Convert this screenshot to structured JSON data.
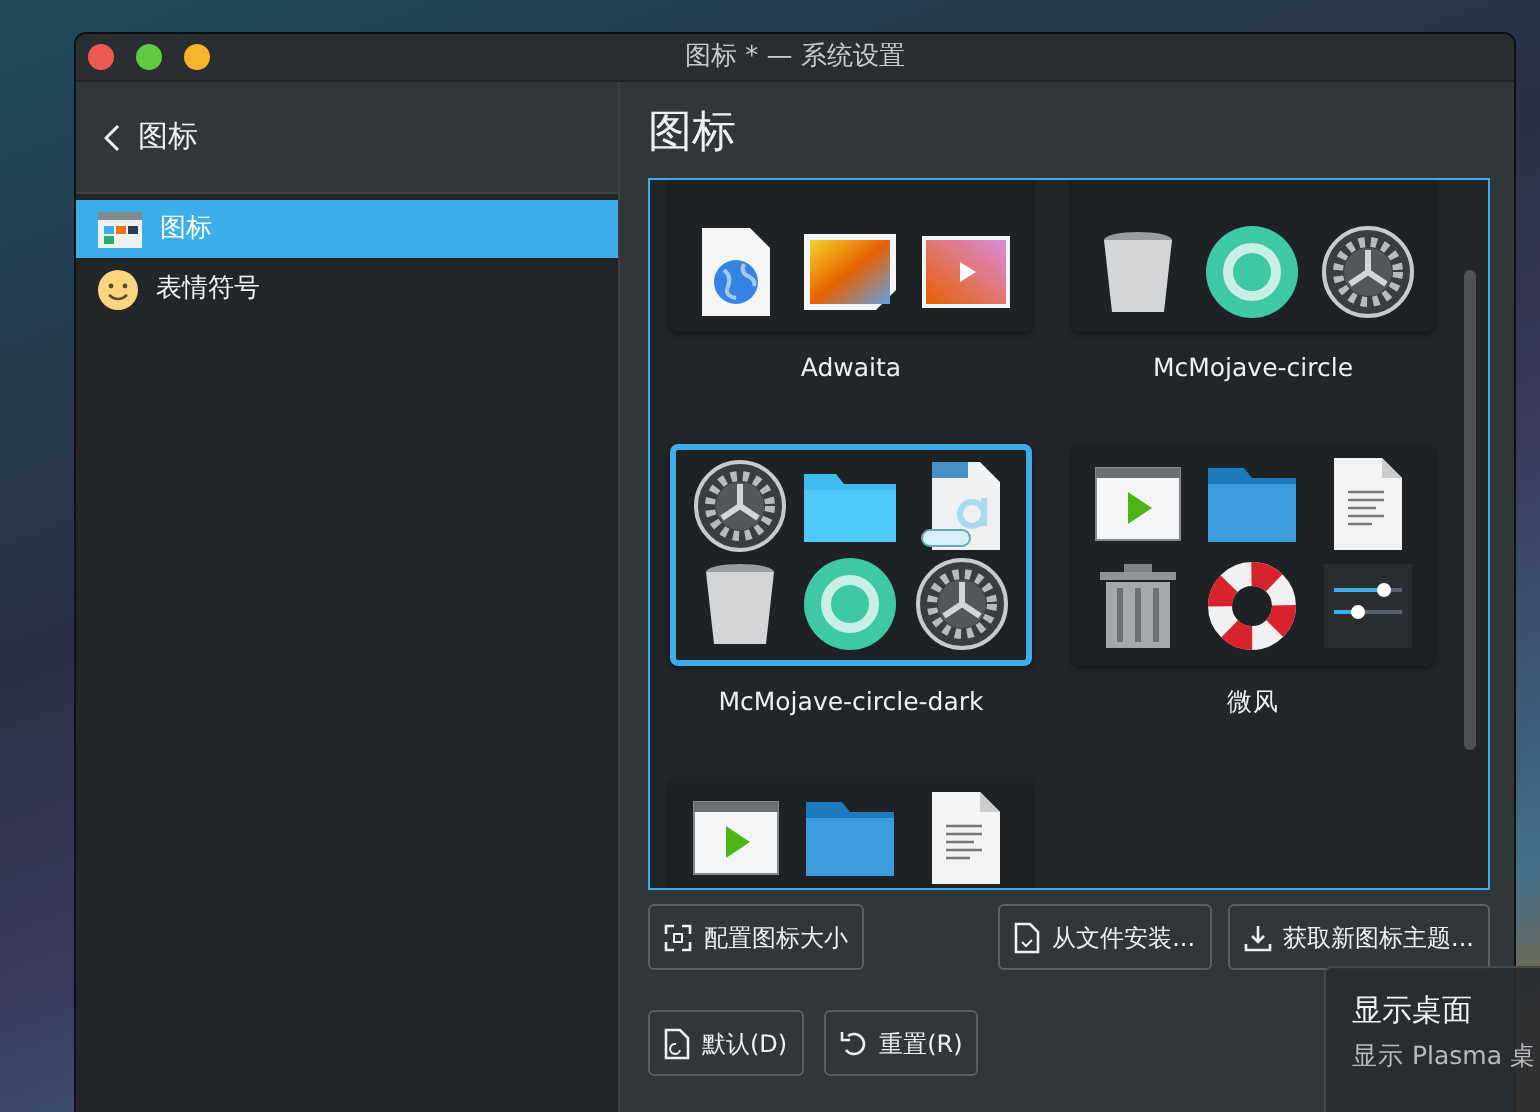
{
  "window": {
    "title": "图标 * — 系统设置"
  },
  "sidebar": {
    "back_label": "图标",
    "items": [
      {
        "label": "图标",
        "selected": true
      },
      {
        "label": "表情符号",
        "selected": false
      }
    ]
  },
  "page": {
    "title": "图标"
  },
  "themes": [
    {
      "name": "Adwaita",
      "selected": false
    },
    {
      "name": "McMojave-circle",
      "selected": false
    },
    {
      "name": "McMojave-circle-dark",
      "selected": true
    },
    {
      "name": "微风",
      "selected": false
    },
    {
      "selected": false
    }
  ],
  "actions": [
    {
      "label": "配置图标大小"
    },
    {
      "label": "从文件安装..."
    },
    {
      "label": "获取新图标主题..."
    }
  ],
  "footer_buttons": [
    {
      "label": "默认(D)"
    },
    {
      "label": "重置(R)"
    }
  ],
  "tooltip": {
    "title": "显示桌面",
    "text": "显示 Plasma 桌"
  }
}
